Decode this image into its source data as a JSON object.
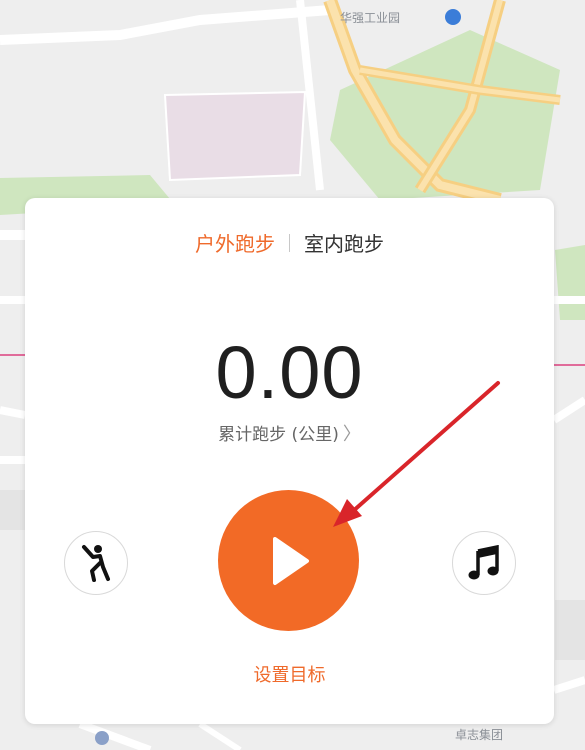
{
  "map": {
    "labels": {
      "industrial_area": "华强工业园",
      "top_block": "",
      "bottom_right": "卓志集团"
    }
  },
  "tabs": [
    {
      "label": "户外跑步",
      "active": true
    },
    {
      "label": "室内跑步",
      "active": false
    }
  ],
  "distance": {
    "value": "0.00",
    "label": "累计跑步 (公里)"
  },
  "controls": {
    "warmup_icon": "stretching-person-icon",
    "start_icon": "play-icon",
    "music_icon": "music-note-icon"
  },
  "goal_label": "设置目标",
  "colors": {
    "accent": "#f26a26",
    "annotation_arrow": "#d9252a"
  }
}
